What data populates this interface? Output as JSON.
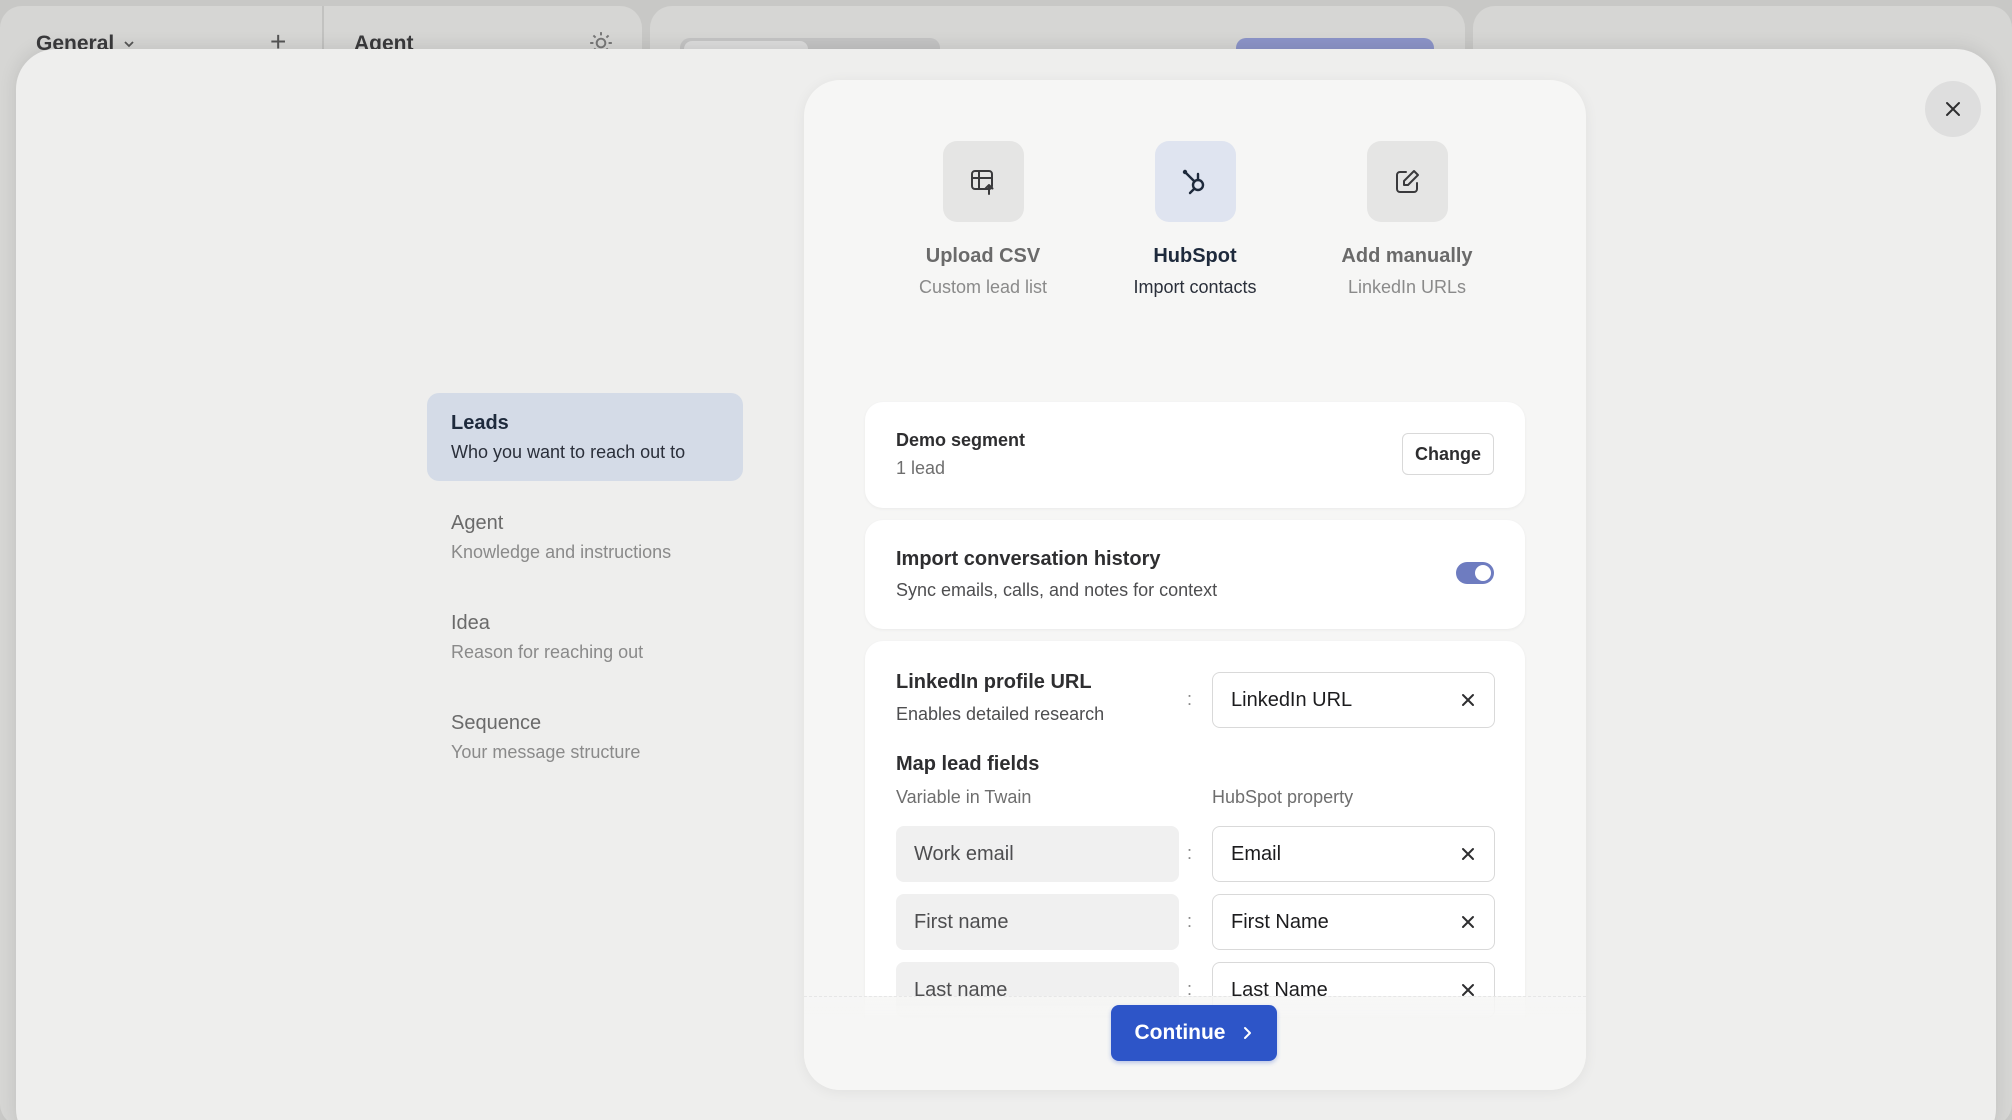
{
  "background": {
    "workspace_label": "General",
    "agent_label": "Agent"
  },
  "steps": [
    {
      "title": "Leads",
      "subtitle": "Who you want to reach out to",
      "active": true
    },
    {
      "title": "Agent",
      "subtitle": "Knowledge and instructions",
      "active": false
    },
    {
      "title": "Idea",
      "subtitle": "Reason for reaching out",
      "active": false
    },
    {
      "title": "Sequence",
      "subtitle": "Your message structure",
      "active": false
    }
  ],
  "sources": [
    {
      "title": "Upload CSV",
      "subtitle": "Custom lead list",
      "icon": "table-upload-icon",
      "selected": false
    },
    {
      "title": "HubSpot",
      "subtitle": "Import contacts",
      "icon": "hubspot-icon",
      "selected": true
    },
    {
      "title": "Add manually",
      "subtitle": "LinkedIn URLs",
      "icon": "edit-icon",
      "selected": false
    }
  ],
  "segment": {
    "name": "Demo segment",
    "count": "1 lead",
    "change_label": "Change"
  },
  "history": {
    "title": "Import conversation history",
    "subtitle": "Sync emails, calls, and notes for context",
    "enabled": true
  },
  "linkedin": {
    "title": "LinkedIn profile URL",
    "subtitle": "Enables detailed research",
    "value": "LinkedIn URL"
  },
  "mapping": {
    "title": "Map lead fields",
    "left_header": "Variable in Twain",
    "right_header": "HubSpot property",
    "rows": [
      {
        "variable": "Work email",
        "property": "Email"
      },
      {
        "variable": "First name",
        "property": "First Name"
      },
      {
        "variable": "Last name",
        "property": "Last Name"
      }
    ]
  },
  "continue_label": "Continue",
  "colors": {
    "accent": "#2d55c8",
    "active_step_bg": "#d4dbe7",
    "toggle_on": "#6e7cc0"
  }
}
